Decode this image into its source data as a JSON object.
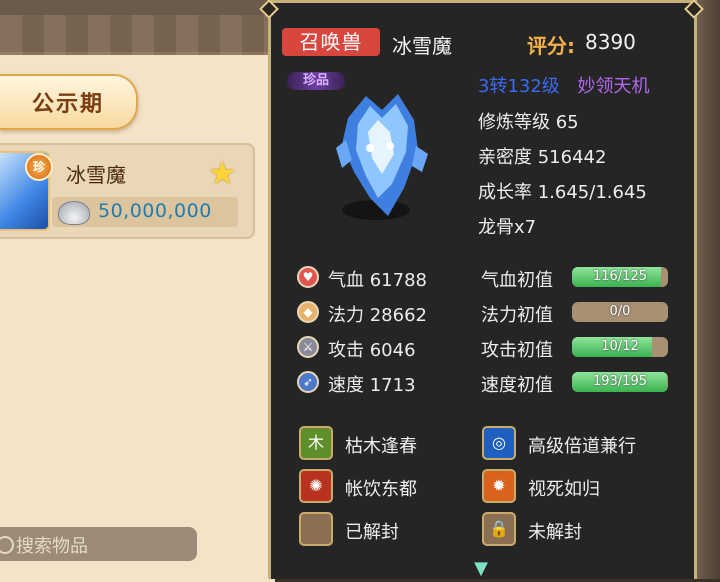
{
  "market": {
    "tab_label": "公示期",
    "item": {
      "badge": "珍",
      "name": "冰雪魔",
      "price": "50,000,000"
    },
    "search_placeholder": "搜索物品"
  },
  "pet": {
    "type_tag": "召唤兽",
    "name": "冰雪魔",
    "score_label": "评分:",
    "score_value": "8390",
    "rare_tag": "珍品",
    "reincarnation": "3转132级",
    "special_skill": "妙领天机",
    "cultivation": "修炼等级 65",
    "intimacy": "亲密度 516442",
    "growth": "成长率 1.645/1.645",
    "dragon_bone": "龙骨x7"
  },
  "stats": [
    {
      "icon": "heart-icon",
      "text": "气血 61788",
      "init_label": "气血初值",
      "bar": "116/125",
      "fill": 0.928,
      "color": "#e0554e"
    },
    {
      "icon": "mana-icon",
      "text": "法力 28662",
      "init_label": "法力初值",
      "bar": "0/0",
      "fill": 0,
      "color": "#e9b26b"
    },
    {
      "icon": "sword-icon",
      "text": "攻击 6046",
      "init_label": "攻击初值",
      "bar": "10/12",
      "fill": 0.833,
      "color": "#8a8a99"
    },
    {
      "icon": "speed-icon",
      "text": "速度 1713",
      "init_label": "速度初值",
      "bar": "193/195",
      "fill": 0.99,
      "color": "#4d79c9"
    }
  ],
  "skills": [
    {
      "name": "枯木逢春",
      "icon": "leaf-skill-icon"
    },
    {
      "name": "高级倍道兼行",
      "icon": "swirl-skill-icon"
    },
    {
      "name": "帐饮东都",
      "icon": "flame-skill-icon"
    },
    {
      "name": "视死如归",
      "icon": "fire-skill-icon"
    },
    {
      "name": "已解封",
      "icon": "empty-slot-icon"
    },
    {
      "name": "未解封",
      "icon": "lock-icon"
    }
  ]
}
